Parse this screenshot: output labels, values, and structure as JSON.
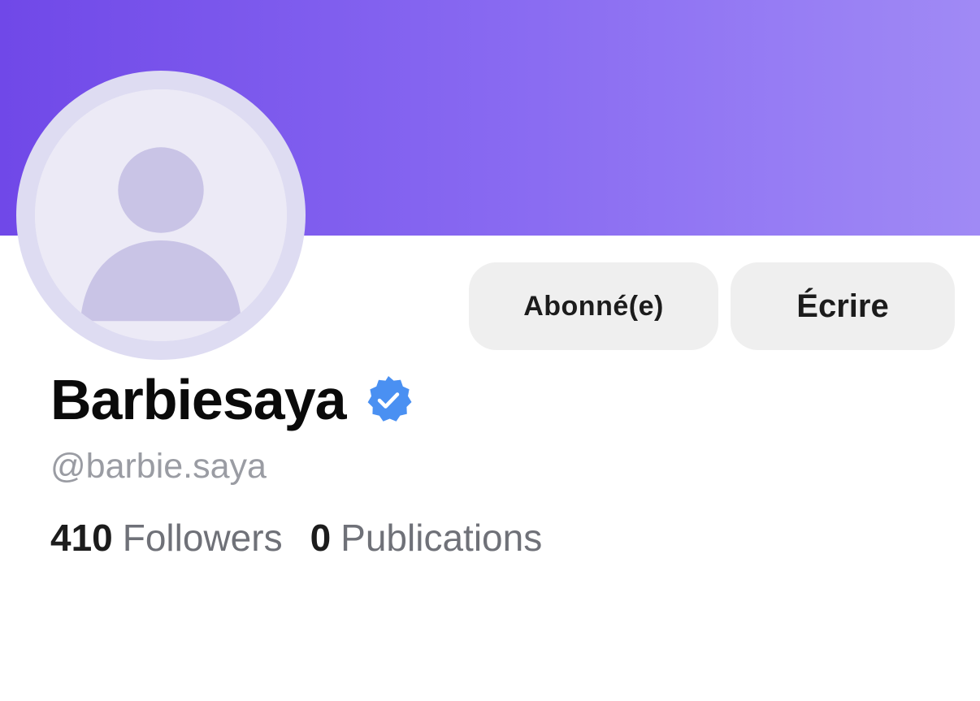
{
  "colors": {
    "banner_start": "#7048e8",
    "banner_end": "#a08af5",
    "verified": "#4a90f2",
    "button_bg": "#efefef"
  },
  "profile": {
    "avatar_icon": "user-avatar-placeholder-icon",
    "display_name": "Barbiesaya",
    "verified_icon": "verified-badge-icon",
    "handle": "@barbie.saya"
  },
  "actions": {
    "subscribed_label": "Abonné(e)",
    "write_label": "Écrire"
  },
  "stats": {
    "followers_count": "410",
    "followers_label": "Followers",
    "publications_count": "0",
    "publications_label": "Publications"
  }
}
